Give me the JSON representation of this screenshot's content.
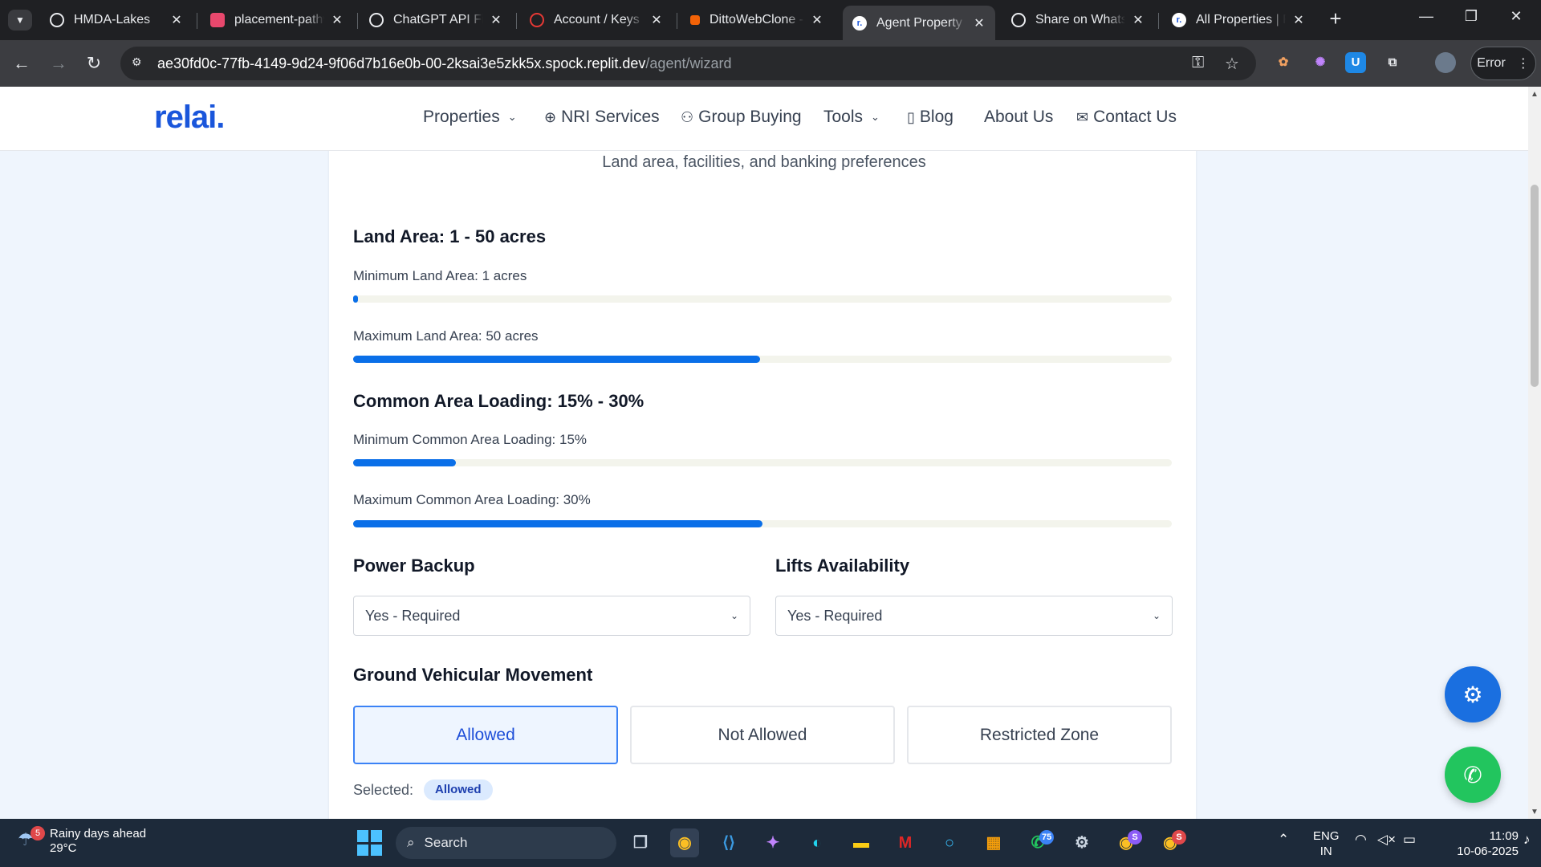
{
  "browser": {
    "tabs": [
      {
        "title": "HMDA-Lakes",
        "icon": "globe-icon",
        "color": "#e8eaed",
        "active": false
      },
      {
        "title": "placement-pathw",
        "icon": "app-logo-icon",
        "color": "#e8486d",
        "active": false
      },
      {
        "title": "ChatGPT API Fix",
        "icon": "openai-icon",
        "color": "#e8eaed",
        "active": false
      },
      {
        "title": "Account / Keys &",
        "icon": "account-icon",
        "color": "#e53935",
        "active": false
      },
      {
        "title": "DittoWebClone -",
        "icon": "replit-icon",
        "color": "#f26207",
        "active": false
      },
      {
        "title": "Agent Property W",
        "icon": "relai-favicon-icon",
        "color": "#ffffff",
        "active": true
      },
      {
        "title": "Share on WhatsA",
        "icon": "globe-icon",
        "color": "#e8eaed",
        "active": false
      },
      {
        "title": "All Properties | R",
        "icon": "relai-favicon-icon",
        "color": "#ffffff",
        "active": false
      }
    ],
    "url_host": "ae30fd0c-77fb-4149-9d24-9f06d7b16e0b-00-2ksai3e5zkk5x.spock.replit.dev",
    "url_path": "/agent/wizard",
    "error_label": "Error"
  },
  "site": {
    "logo": "relai.",
    "brand_color": "#1a56db",
    "nav": [
      {
        "label": "Properties",
        "icon": "",
        "dropdown": true
      },
      {
        "label": "NRI Services",
        "icon": "globe-icon",
        "dropdown": false
      },
      {
        "label": "Group Buying",
        "icon": "users-icon",
        "dropdown": false
      },
      {
        "label": "Tools",
        "icon": "",
        "dropdown": true
      },
      {
        "label": "Blog",
        "icon": "book-icon",
        "dropdown": false
      },
      {
        "label": "About Us",
        "icon": "",
        "dropdown": false
      },
      {
        "label": "Contact Us",
        "icon": "mail-icon",
        "dropdown": false
      }
    ]
  },
  "form": {
    "subtitle": "Land area, facilities, and banking preferences",
    "land_area": {
      "heading": "Land Area: 1 - 50 acres",
      "min_label": "Minimum Land Area: 1 acres",
      "min_fraction": 0.004,
      "max_label": "Maximum Land Area: 50 acres",
      "max_fraction": 0.497
    },
    "common_area": {
      "heading": "Common Area Loading: 15% - 30%",
      "min_label": "Minimum Common Area Loading: 15%",
      "min_fraction": 0.125,
      "max_label": "Maximum Common Area Loading: 30%",
      "max_fraction": 0.5
    },
    "power_backup": {
      "heading": "Power Backup",
      "value": "Yes - Required"
    },
    "lifts": {
      "heading": "Lifts Availability",
      "value": "Yes - Required"
    },
    "vehicular": {
      "heading": "Ground Vehicular Movement",
      "options": [
        "Allowed",
        "Not Allowed",
        "Restricted Zone"
      ],
      "selected_index": 0,
      "selected_label": "Selected:",
      "selected_value": "Allowed"
    },
    "accent_color": "#0a6fe8"
  },
  "fabs": [
    {
      "name": "chatbot-button",
      "icon": "robot-icon",
      "color": "#1a6fe0"
    },
    {
      "name": "whatsapp-button",
      "icon": "whatsapp-icon",
      "color": "#22c55e"
    }
  ],
  "taskbar": {
    "weather_badge": "5",
    "weather_title": "Rainy days ahead",
    "weather_temp": "29°C",
    "search_label": "Search",
    "whatsapp_badge": "75",
    "chrome_badge_1": "S",
    "chrome_badge_2": "S",
    "lang_1": "ENG",
    "lang_2": "IN",
    "time": "11:09",
    "date": "10-06-2025"
  }
}
